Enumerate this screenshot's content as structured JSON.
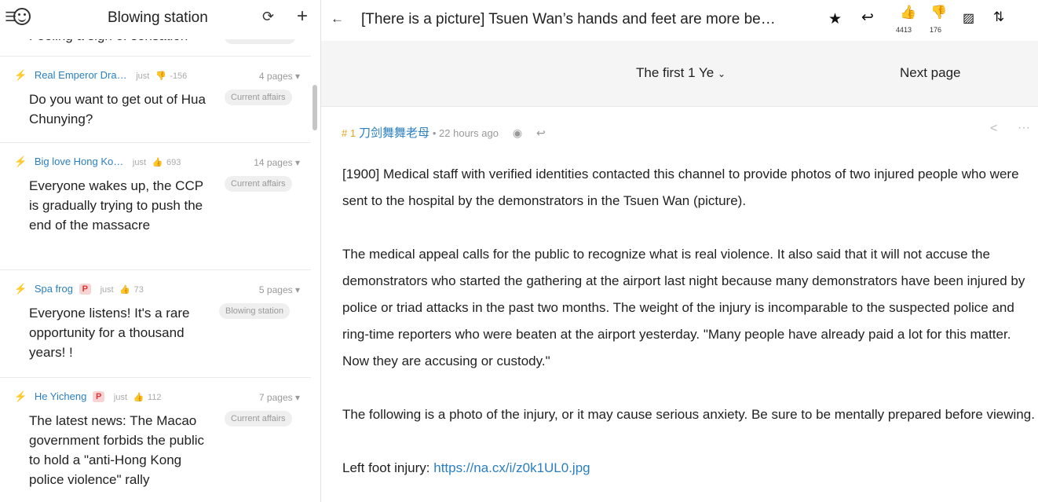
{
  "left": {
    "title": "Blowing station",
    "cut_text": "Feeling a sigh of sensation",
    "threads": [
      {
        "author": "Real Emperor Dra…",
        "p": "",
        "time": "just",
        "likes": "-156",
        "likes_icon": "thumb-down",
        "pages": "4 pages",
        "title": "Do you want to get out of Hua Chunying?",
        "tag": "Current affairs"
      },
      {
        "author": "Big love Hong Ko…",
        "p": "",
        "time": "just",
        "likes": "693",
        "likes_icon": "thumb-up",
        "pages": "14 pages",
        "title": "Everyone wakes up, the CCP is gradually trying to push the end of the massacre",
        "tag": "Current affairs"
      },
      {
        "author": "Spa frog",
        "p": "P",
        "time": "just",
        "likes": "73",
        "likes_icon": "thumb-up",
        "pages": "5 pages",
        "title": "Everyone listens! It's a rare opportunity for a thousand years! !",
        "tag": "Blowing station"
      },
      {
        "author": "He Yicheng",
        "p": "P",
        "time": "just",
        "likes": "112",
        "likes_icon": "thumb-up",
        "pages": "7 pages",
        "title": "The latest news: The Macao government forbids the public to hold a \"anti-Hong Kong police violence\" rally",
        "tag": "Current affairs"
      }
    ]
  },
  "right": {
    "title": "[There is a picture] Tsuen Wan’s hands and feet are more be…",
    "like_count": "4413",
    "dislike_count": "176",
    "pager": {
      "first": "The first 1 Ye",
      "next": "Next page"
    },
    "post": {
      "num": "# 1",
      "author": "刀剑舞舞老母",
      "time": "22 hours ago",
      "paragraphs": [
        "[1900] Medical staff with verified identities contacted this channel to provide photos of two injured people who were sent to the hospital by the demonstrators in the Tsuen Wan (picture).",
        "The medical appeal calls for the public to recognize what is real violence. It also said that it will not accuse the demonstrators who started the gathering at the airport last night because many demonstrators have been injured by police or triad attacks in the past two months. The weight of the injury is incomparable to the suspected police and ring-time reporters who were beaten at the airport yesterday. \"Many people have already paid a lot for this matter. Now they are accusing or custody.\"",
        "The following is a photo of the injury, or it may cause serious anxiety. Be sure to be mentally prepared before viewing."
      ],
      "link_label": "Left foot injury: ",
      "link_url": "https://na.cx/i/z0k1UL0.jpg"
    }
  }
}
